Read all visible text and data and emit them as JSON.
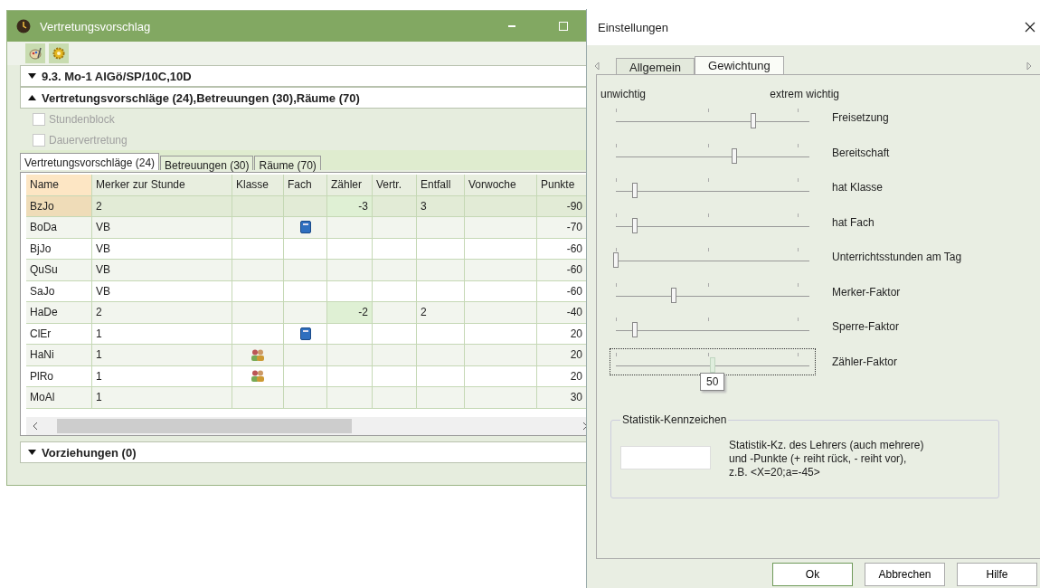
{
  "main_window": {
    "title": "Vertretungsvorschlag",
    "sections": [
      {
        "label": "9.3. Mo-1 AlGö/SP/10C,10D",
        "expanded": false
      },
      {
        "label": "Vertretungsvorschläge (24),Betreuungen (30),Räume (70)",
        "expanded": true
      }
    ],
    "options": [
      {
        "label": "Stundenblock",
        "checked": false,
        "disabled": true
      },
      {
        "label": "Dauervertretung",
        "checked": false,
        "disabled": true
      }
    ],
    "tabs": [
      {
        "label": "Vertretungsvorschläge (24)",
        "selected": true
      },
      {
        "label": "Betreuungen (30)",
        "selected": false
      },
      {
        "label": "Räume (70)",
        "selected": false
      }
    ],
    "table": {
      "columns": [
        "Name",
        "Merker zur Stunde",
        "Klasse",
        "Fach",
        "Zähler",
        "Vertr.",
        "Entfall",
        "Vorwoche",
        "Punkte"
      ],
      "rows": [
        {
          "name": "BzJo",
          "merker": "2",
          "zaehler": "-3",
          "entfall": "3",
          "punkte": "-90",
          "selected": true
        },
        {
          "name": "BoDa",
          "merker": "VB",
          "fach_book": true,
          "punkte": "-70",
          "selected": false
        },
        {
          "name": "BjJo",
          "merker": "VB",
          "punkte": "-60",
          "selected": false
        },
        {
          "name": "QuSu",
          "merker": "VB",
          "punkte": "-60",
          "selected": false
        },
        {
          "name": "SaJo",
          "merker": "VB",
          "punkte": "-60",
          "selected": false
        },
        {
          "name": "HaDe",
          "merker": "2",
          "zaehler": "-2",
          "entfall": "2",
          "punkte": "-40",
          "selected": false
        },
        {
          "name": "ClEr",
          "merker": "1",
          "fach_book": true,
          "punkte": "20",
          "selected": false
        },
        {
          "name": "HaNi",
          "merker": "1",
          "klasse_group": true,
          "punkte": "20",
          "selected": false
        },
        {
          "name": "PlRo",
          "merker": "1",
          "klasse_group": true,
          "punkte": "20",
          "selected": false
        },
        {
          "name": "MoAl",
          "merker": "1",
          "punkte": "30",
          "selected": false
        }
      ]
    },
    "footer_section": {
      "label": "Vorziehungen (0)",
      "expanded": false
    }
  },
  "dialog": {
    "title": "Einstellungen",
    "tabs": [
      {
        "label": "Allgemein",
        "selected": false
      },
      {
        "label": "Gewichtung",
        "selected": true
      }
    ],
    "scale_low": "unwichtig",
    "scale_high": "extrem wichtig",
    "sliders": [
      {
        "label": "Freisetzung",
        "level": 0.71,
        "focused": false
      },
      {
        "label": "Bereitschaft",
        "level": 0.61,
        "focused": false
      },
      {
        "label": "hat Klasse",
        "level": 0.1,
        "focused": false
      },
      {
        "label": "hat Fach",
        "level": 0.1,
        "focused": false
      },
      {
        "label": "Unterrichtsstunden am Tag",
        "level": 0,
        "focused": false
      },
      {
        "label": "Merker-Faktor",
        "level": 0.3,
        "focused": false
      },
      {
        "label": "Sperre-Faktor",
        "level": 0.1,
        "focused": false
      },
      {
        "label": "Zähler-Faktor",
        "level": 0.5,
        "focused": true,
        "tooltip": "50"
      }
    ],
    "statistics": {
      "legend": "Statistik-Kennzeichen",
      "hint": "Statistik-Kz. des Lehrers (auch mehrere)\nund -Punkte (+ reiht rück, - reiht vor),\nz.B. <X=20;a=-45>"
    },
    "buttons": [
      "Ok",
      "Abbrechen",
      "Hilfe"
    ]
  }
}
